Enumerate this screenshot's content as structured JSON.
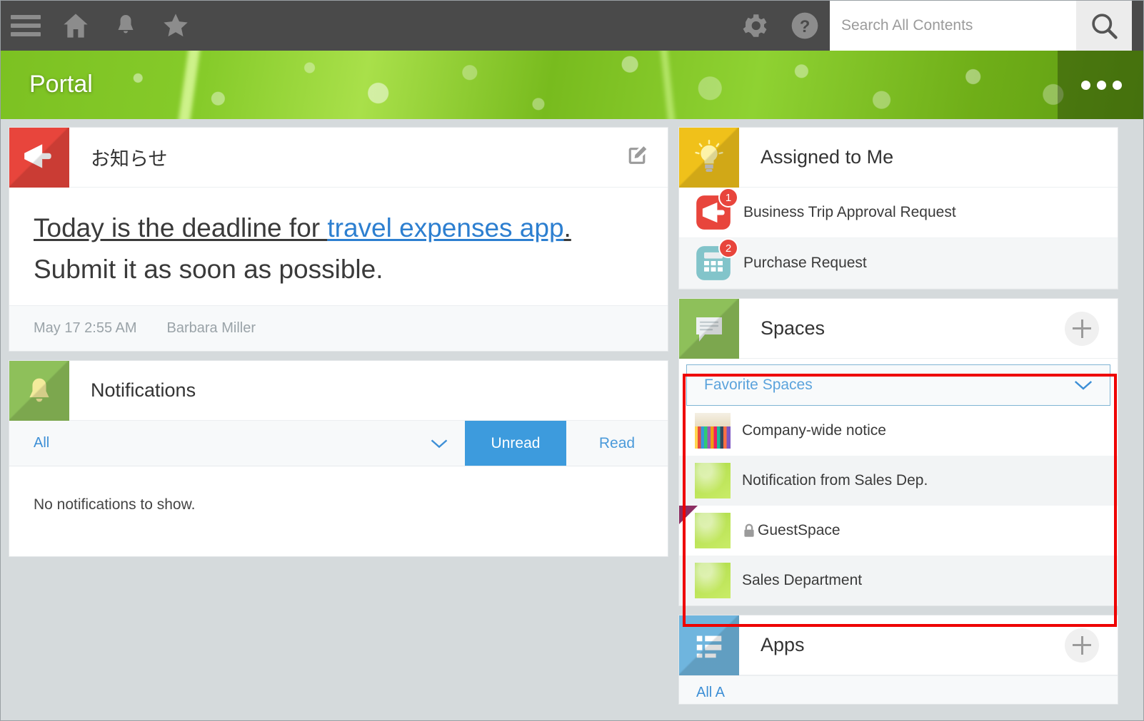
{
  "topbar": {
    "icons": [
      {
        "name": "menu-icon",
        "label": "Menu"
      },
      {
        "name": "home-icon",
        "label": "Home"
      },
      {
        "name": "bell-icon",
        "label": "Notifications"
      },
      {
        "name": "star-icon",
        "label": "Favorites"
      },
      {
        "name": "gear-icon",
        "label": "Settings"
      },
      {
        "name": "help-icon",
        "label": "Help"
      }
    ],
    "search": {
      "placeholder": "Search All Contents",
      "value": "",
      "button_icon": "search-icon"
    }
  },
  "banner": {
    "title": "Portal",
    "menu_icon": "ellipsis-icon"
  },
  "announcement": {
    "icon": "megaphone-icon",
    "title": "お知らせ",
    "edit_icon": "compose-icon",
    "body_prefix": "Today is the deadline for ",
    "body_link": "travel expenses app",
    "body_suffix": ".",
    "body_line2": "Submit it as soon as possible.",
    "timestamp": "May 17 2:55 AM",
    "author": "Barbara Miller"
  },
  "notifications": {
    "icon": "bell-icon",
    "title": "Notifications",
    "filter_label": "All",
    "filter_chevron": "chevron-down-icon",
    "tab_unread": "Unread",
    "tab_read": "Read",
    "active_tab": "Unread",
    "empty_message": "No notifications to show."
  },
  "assigned": {
    "icon": "lightbulb-icon",
    "title": "Assigned to Me",
    "items": [
      {
        "label": "Business Trip Approval Request",
        "badge": "1",
        "icon": "megaphone-icon"
      },
      {
        "label": "Purchase Request",
        "badge": "2",
        "icon": "calculator-icon"
      }
    ]
  },
  "spaces": {
    "icon": "chat-bubble-icon",
    "title": "Spaces",
    "add_icon": "plus-icon",
    "filter_label": "Favorite Spaces",
    "filter_chevron": "chevron-down-icon",
    "items": [
      {
        "label": "Company-wide notice",
        "thumb": "pencils-thumbnail",
        "locked": false,
        "flagged": false
      },
      {
        "label": "Notification from Sales Dep.",
        "thumb": "leaf-thumbnail",
        "locked": false,
        "flagged": false
      },
      {
        "label": "GuestSpace",
        "thumb": "leaf-thumbnail",
        "locked": true,
        "lock_icon": "lock-icon",
        "flagged": true
      },
      {
        "label": "Sales Department",
        "thumb": "leaf-thumbnail",
        "locked": false,
        "flagged": false
      }
    ]
  },
  "apps": {
    "icon": "list-icon",
    "title": "Apps",
    "add_icon": "plus-icon",
    "filter_label": "All A"
  },
  "colors": {
    "topbar_bg": "#4a4a4a",
    "accent_blue": "#3d9bdd",
    "link_blue": "#2d7fd0",
    "announcement_icon_bg": "#e8453c",
    "notifications_icon_bg": "#8ec05a",
    "assigned_icon_bg": "#f0c11a",
    "spaces_icon_bg": "#8ec05a",
    "apps_icon_bg": "#6fb5de",
    "badge_red": "#e8453c",
    "annotation_red": "#ee0000",
    "page_bg": "#d5dadc"
  }
}
